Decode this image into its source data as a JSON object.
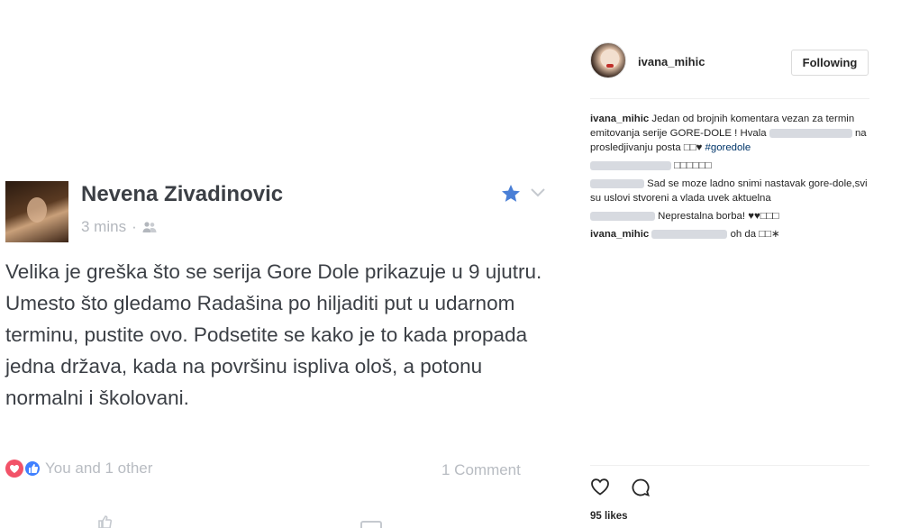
{
  "facebook_post": {
    "author": "Nevena Zivadinovic",
    "time": "3 mins",
    "separator": "·",
    "audience_icon": "friends-icon",
    "text": "Velika je greška što se serija Gore Dole prikazuje u 9 ujutru. Umesto što gledamo Radašina po hiljaditi put u udarnom terminu, pustite ovo. Podsetite se kako je to kada propada jedna država, kada na površinu ispliva ološ, a potonu normalni i školovani.",
    "reactions_text": "You and 1 other",
    "comments_count": "1 Comment",
    "colors": {
      "accent": "#4080ff",
      "love": "#f25268",
      "muted": "#b8bcc2"
    }
  },
  "instagram": {
    "username": "ivana_mihic",
    "follow_button": "Following",
    "comments": [
      {
        "user": "ivana_mihic",
        "text": "Jedan od brojnih komentara vezan za termin emitovanja serije GORE-DOLE ! Hvala",
        "text_after": "na prosledjivanju posta □□♥",
        "hashtag": "#goredole"
      },
      {
        "user": "",
        "text": "□□□□□□"
      },
      {
        "user": "",
        "text": "Sad se moze ladno snimi nastavak gore-dole,svi su uslovi stvoreni a vlada uvek aktuelna"
      },
      {
        "user": "",
        "text": "Neprestalna borba! ♥♥□□□"
      },
      {
        "user": "ivana_mihic",
        "text": "oh da □□∗"
      }
    ],
    "likes": "95 likes",
    "icons": [
      "heart-icon",
      "comment-icon"
    ]
  }
}
